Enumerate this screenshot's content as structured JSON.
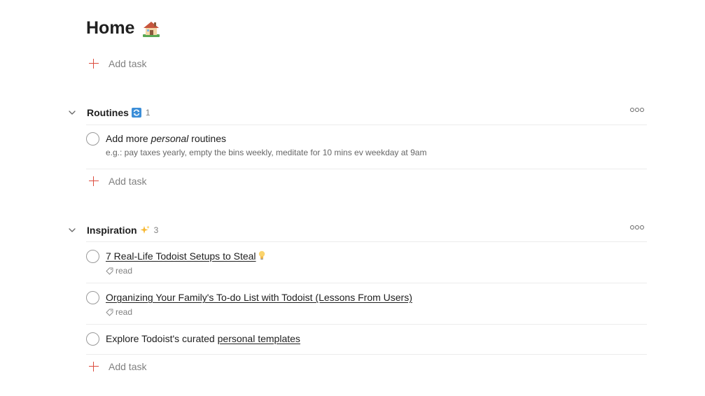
{
  "page": {
    "title": "Home",
    "title_icon": "house-emoji"
  },
  "add_task_label": "Add task",
  "sections": [
    {
      "name": "Routines",
      "icon": "repeat-emoji",
      "count": "1",
      "tasks": [
        {
          "title_pre": "Add more ",
          "title_em": "personal",
          "title_post": " routines",
          "description": "e.g.: pay taxes yearly, empty the bins weekly, meditate for 10 mins ev weekday at 9am"
        }
      ]
    },
    {
      "name": "Inspiration",
      "icon": "sparkles-emoji",
      "count": "3",
      "tasks": [
        {
          "title_link": "7 Real-Life Todoist Setups to Steal",
          "title_icon": "lightbulb-emoji",
          "label": "read"
        },
        {
          "title_link": "Organizing Your Family's To-do List with Todoist (Lessons From Users)",
          "label": "read"
        },
        {
          "title_pre": "Explore Todoist's curated ",
          "title_link": "personal templates"
        }
      ]
    }
  ],
  "colors": {
    "accent": "#dc4c3e",
    "text": "#202020",
    "muted": "#808080",
    "divider": "#ececec"
  }
}
